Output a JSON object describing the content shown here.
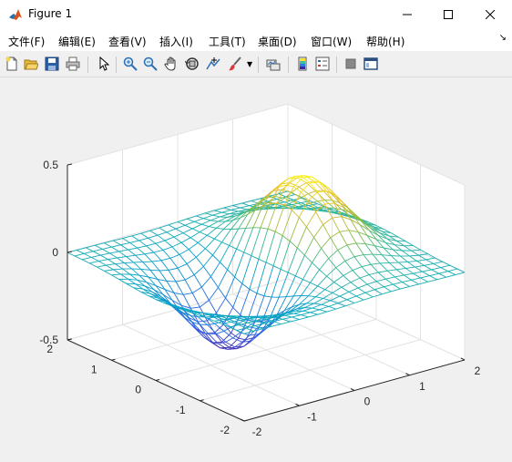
{
  "window": {
    "title": "Figure 1"
  },
  "menu": [
    "文件(F)",
    "编辑(E)",
    "查看(V)",
    "插入(I)",
    "工具(T)",
    "桌面(D)",
    "窗口(W)",
    "帮助(H)"
  ],
  "toolbar": [
    "new-figure-icon",
    "open-file-icon",
    "save-icon",
    "print-icon",
    "pointer-icon",
    "zoom-in-icon",
    "zoom-out-icon",
    "pan-icon",
    "rotate-3d-icon",
    "data-cursor-icon",
    "brush-icon",
    "brush-dropdown-icon",
    "link-plot-icon",
    "colorbar-icon",
    "legend-icon",
    "hide-plot-tools-icon",
    "show-plot-tools-icon"
  ],
  "chart_data": {
    "type": "surface-mesh",
    "function": "x*exp(-x^2-y^2)",
    "x": [
      -2,
      2
    ],
    "y": [
      -2,
      2
    ],
    "grid_points": 25,
    "zlim": [
      -0.5,
      0.5
    ],
    "zticks": [
      "0.5",
      "0",
      "-0.5"
    ],
    "xticks": [
      "-2",
      "-1",
      "0",
      "1",
      "2"
    ],
    "yticks": [
      "-2",
      "-1",
      "0",
      "1",
      "2"
    ],
    "colormap": "parula",
    "grid": true
  }
}
